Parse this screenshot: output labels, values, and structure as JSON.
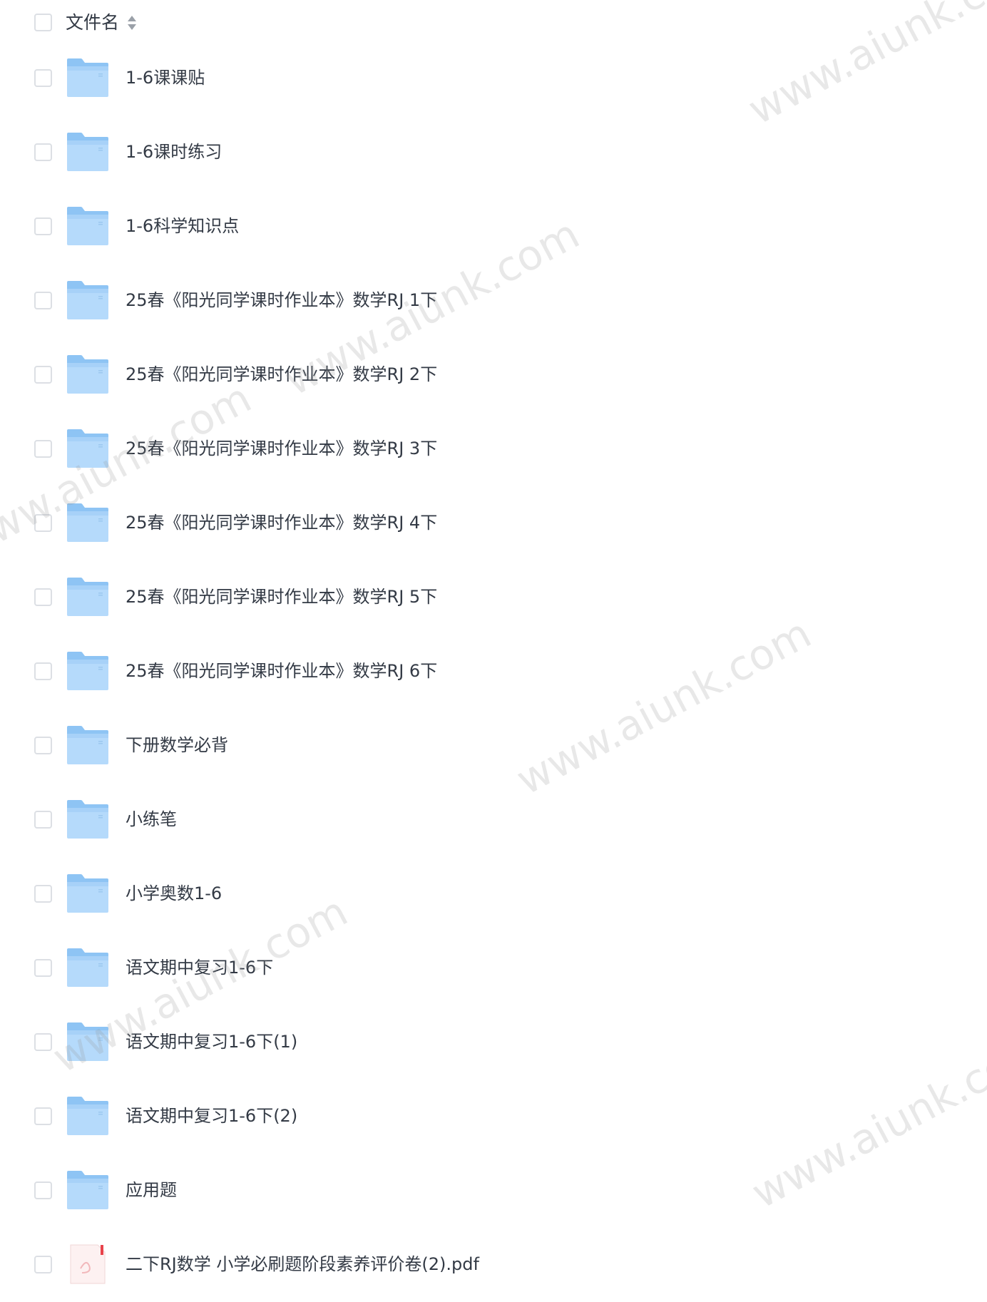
{
  "header": {
    "label": "文件名"
  },
  "items": [
    {
      "name": "1-6课课贴",
      "type": "folder"
    },
    {
      "name": "1-6课时练习",
      "type": "folder"
    },
    {
      "name": "1-6科学知识点",
      "type": "folder"
    },
    {
      "name": "25春《阳光同学课时作业本》数学RJ 1下",
      "type": "folder"
    },
    {
      "name": "25春《阳光同学课时作业本》数学RJ 2下",
      "type": "folder"
    },
    {
      "name": "25春《阳光同学课时作业本》数学RJ 3下",
      "type": "folder"
    },
    {
      "name": "25春《阳光同学课时作业本》数学RJ 4下",
      "type": "folder"
    },
    {
      "name": "25春《阳光同学课时作业本》数学RJ 5下",
      "type": "folder"
    },
    {
      "name": "25春《阳光同学课时作业本》数学RJ 6下",
      "type": "folder"
    },
    {
      "name": "下册数学必背",
      "type": "folder"
    },
    {
      "name": "小练笔",
      "type": "folder"
    },
    {
      "name": "小学奥数1-6",
      "type": "folder"
    },
    {
      "name": "语文期中复习1-6下",
      "type": "folder"
    },
    {
      "name": "语文期中复习1-6下(1)",
      "type": "folder"
    },
    {
      "name": "语文期中复习1-6下(2)",
      "type": "folder"
    },
    {
      "name": "应用题",
      "type": "folder"
    },
    {
      "name": "二下RJ数学 小学必刷题阶段素养评价卷(2).pdf",
      "type": "pdf"
    }
  ],
  "watermark": "www.aiunk.com",
  "colors": {
    "folder_top": "#8ec4f4",
    "folder_body": "#b5dafb",
    "checkbox_border": "#dcdfe4",
    "text": "#333a45",
    "pdf_red": "#e8434b"
  },
  "icons": {
    "folder": "folder-icon",
    "pdf": "pdf-file-icon",
    "sort": "sort-icon"
  }
}
